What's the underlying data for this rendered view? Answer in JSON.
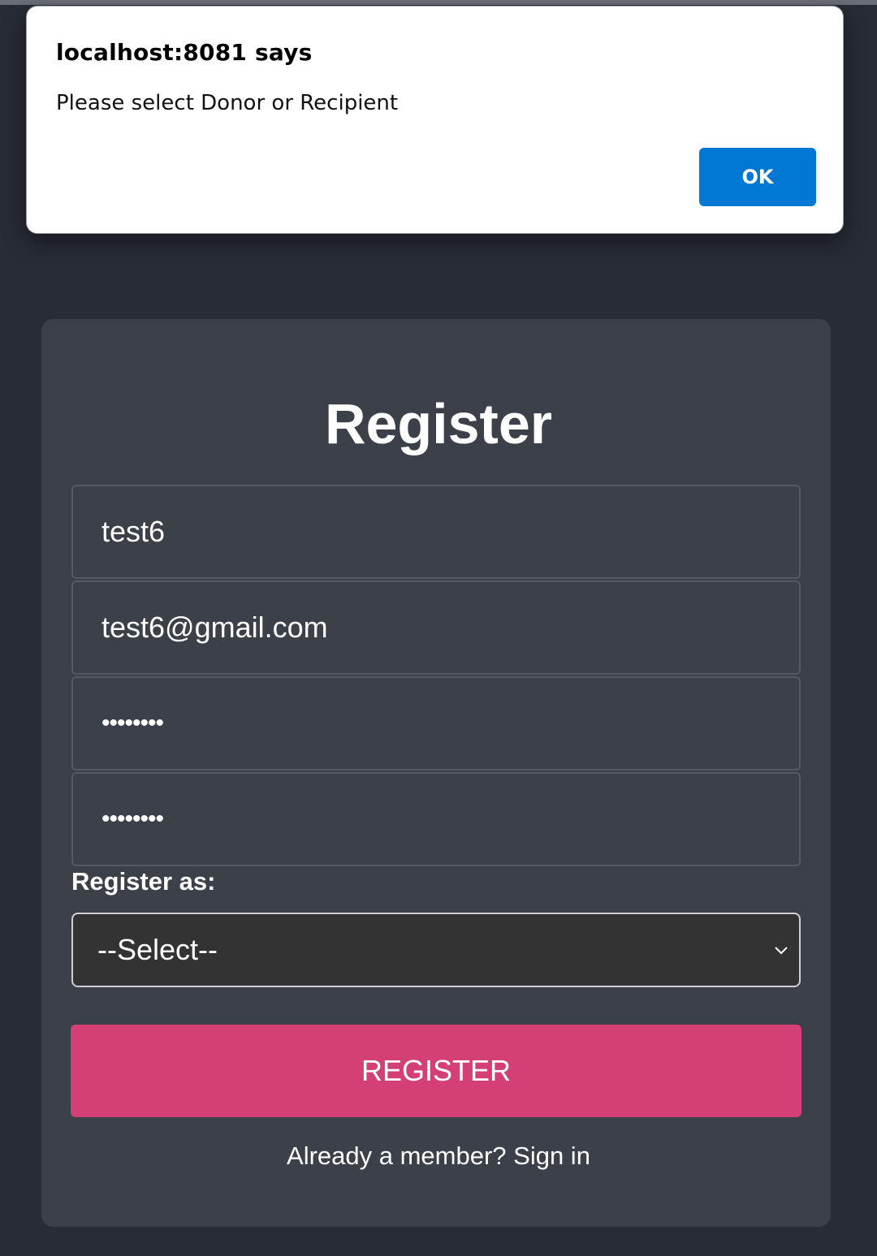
{
  "dialog": {
    "title": "localhost:8081 says",
    "message": "Please select Donor or Recipient",
    "ok_label": "OK"
  },
  "form": {
    "title": "Register",
    "username_value": "test6",
    "email_value": "test6@gmail.com",
    "password_value": "••••••••",
    "confirm_password_value": "••••••••",
    "register_as_label": "Register as:",
    "role_select_value": "--Select--",
    "register_button_label": "REGISTER",
    "signin_text": "Already a member? Sign in"
  },
  "colors": {
    "background": "#282c34",
    "card": "#3b4049",
    "accent": "#d44076",
    "dialog_button": "#0078d4"
  },
  "icons": {
    "select_chevron": "chevron-down-icon"
  }
}
